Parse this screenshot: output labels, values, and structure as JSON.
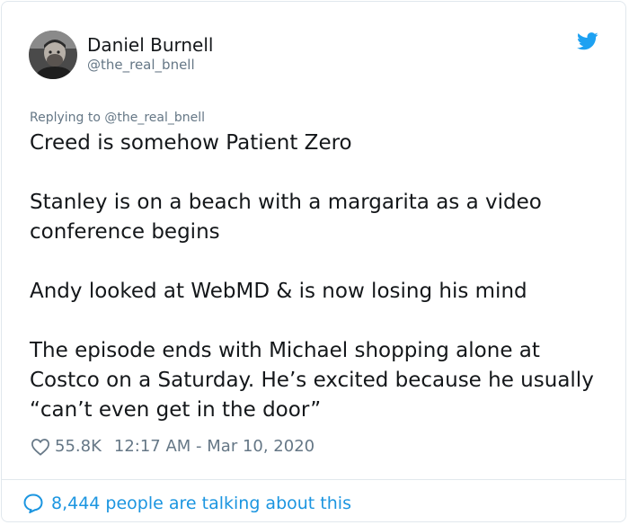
{
  "author": {
    "display_name": "Daniel Burnell",
    "handle": "@the_real_bnell",
    "avatar_icon": "user-avatar"
  },
  "brand": {
    "icon": "twitter-bird-icon",
    "color": "#1da1f2"
  },
  "reply": {
    "label": "Replying to @the_real_bnell"
  },
  "tweet": {
    "paragraphs": [
      "Creed is somehow Patient Zero",
      "Stanley is on a beach with a margarita as a video conference begins",
      "Andy looked at WebMD & is now losing his mind",
      "The episode ends with Michael shopping alone at Costco on a Saturday. He’s excited because he usually “can’t even get in the door”"
    ]
  },
  "meta": {
    "likes": "55.8K",
    "timestamp": "12:17 AM - Mar 10, 2020",
    "heart_icon": "heart-icon"
  },
  "footer": {
    "talking_label": "8,444 people are talking about this",
    "bubble_icon": "speech-bubble-icon",
    "link_color": "#1b95e0"
  }
}
